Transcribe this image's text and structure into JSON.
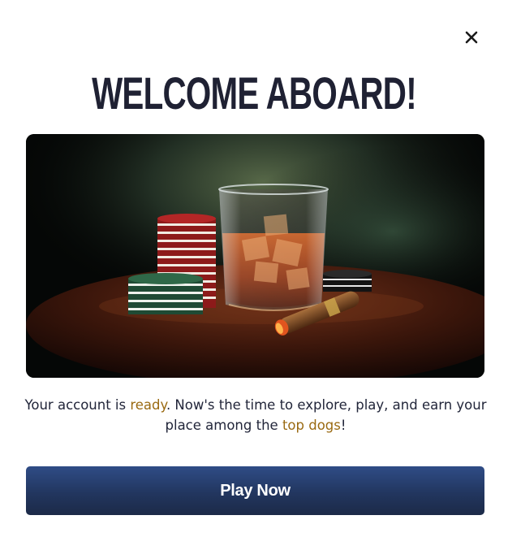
{
  "modal": {
    "title": "WELCOME ABOARD!",
    "close_icon": "close-icon",
    "hero_image": {
      "subject": "whiskey glass with ice, poker chips and a cigar on a wooden table"
    },
    "message": {
      "part1": "Your account is ",
      "highlight1": "ready",
      "part2": ". Now's the time to explore, play, and earn your place among the ",
      "highlight2": "top dogs",
      "part3": "!"
    },
    "play_button_label": "Play Now"
  },
  "colors": {
    "title": "#1f2133",
    "highlight": "#9a6a12",
    "button_top": "#2f4c86",
    "button_bottom": "#1c2a48",
    "text": "#22263a"
  }
}
